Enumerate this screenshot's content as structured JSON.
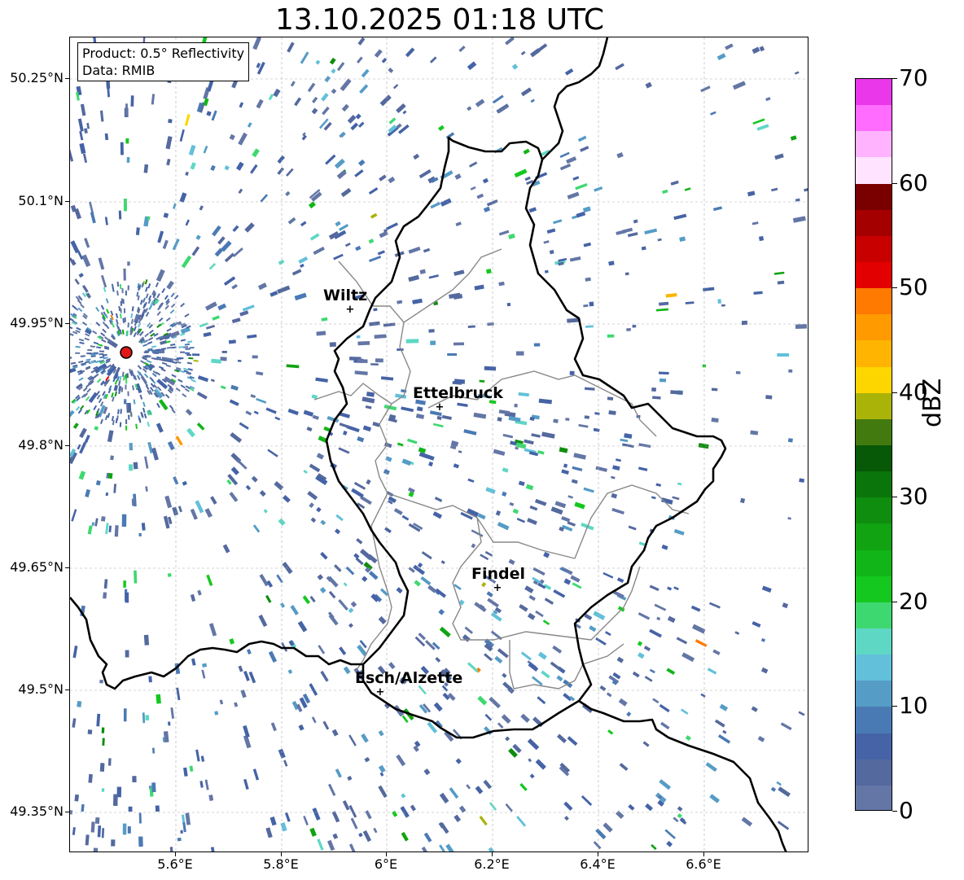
{
  "title": "13.10.2025 01:18 UTC",
  "info": {
    "product": "Product: 0.5° Reflectivity",
    "data": "Data: RMIB"
  },
  "axes": {
    "lat_labels": [
      "50.25°N",
      "50.1°N",
      "49.95°N",
      "49.8°N",
      "49.65°N",
      "49.5°N",
      "49.35°N"
    ],
    "lon_labels": [
      "5.6°E",
      "5.8°E",
      "6°E",
      "6.2°E",
      "6.4°E",
      "6.6°E"
    ]
  },
  "cities": [
    {
      "name": "Wiltz"
    },
    {
      "name": "Ettelbruck"
    },
    {
      "name": "Findel"
    },
    {
      "name": "Esch/Alzette"
    }
  ],
  "colorbar": {
    "unit": "dBZ",
    "tick_labels": [
      "70",
      "60",
      "50",
      "40",
      "30",
      "20",
      "10",
      "0"
    ],
    "colors": [
      "#6376a6",
      "#54699e",
      "#4563a6",
      "#4a7ab4",
      "#559cc6",
      "#62c0da",
      "#5ed7c4",
      "#3ed870",
      "#15c81f",
      "#12b518",
      "#11a312",
      "#0e8d0e",
      "#0a750a",
      "#075807",
      "#437a10",
      "#aab308",
      "#fdd600",
      "#feb400",
      "#ff9a00",
      "#ff7a00",
      "#e30000",
      "#c80000",
      "#a50000",
      "#7a0000",
      "#ffe3ff",
      "#ffb3ff",
      "#ff6cff",
      "#ea37ea"
    ]
  }
}
